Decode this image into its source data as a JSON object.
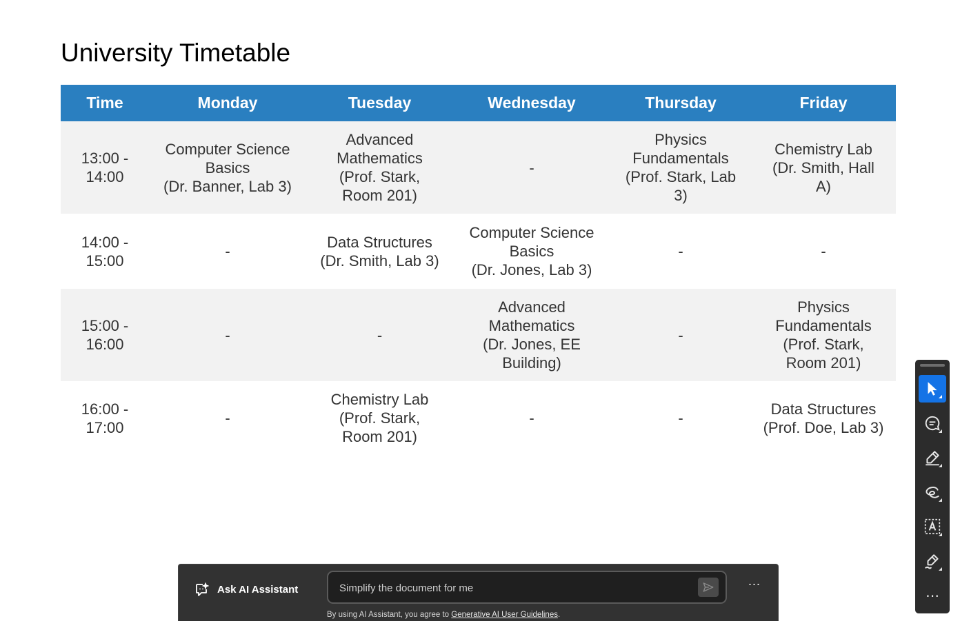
{
  "page": {
    "title": "University Timetable"
  },
  "timetable": {
    "headers": [
      "Time",
      "Monday",
      "Tuesday",
      "Wednesday",
      "Thursday",
      "Friday"
    ],
    "rows": [
      {
        "time": "13:00 -\n14:00",
        "cells": [
          "Computer Science\nBasics\n(Dr. Banner, Lab 3)",
          "Advanced\nMathematics\n(Prof. Stark,\nRoom 201)",
          "-",
          "Physics\nFundamentals\n(Prof. Stark, Lab\n3)",
          "Chemistry Lab\n(Dr. Smith, Hall\nA)"
        ]
      },
      {
        "time": "14:00 -\n15:00",
        "cells": [
          "-",
          "Data Structures\n(Dr. Smith, Lab 3)",
          "Computer Science\nBasics\n(Dr. Jones, Lab 3)",
          "-",
          "-"
        ]
      },
      {
        "time": "15:00 -\n16:00",
        "cells": [
          "-",
          "-",
          "Advanced\nMathematics\n(Dr. Jones, EE\nBuilding)",
          "-",
          "Physics\nFundamentals\n(Prof. Stark,\nRoom 201)"
        ]
      },
      {
        "time": "16:00 -\n17:00",
        "cells": [
          "-",
          "Chemistry Lab\n(Prof. Stark,\nRoom 201)",
          "-",
          "-",
          "Data Structures\n(Prof. Doe, Lab 3)"
        ]
      }
    ]
  },
  "tool_rail": {
    "tools": [
      {
        "name": "select-tool",
        "icon": "cursor-arrow-icon",
        "active": true
      },
      {
        "name": "comment-tool",
        "icon": "comment-bubble-icon",
        "active": false
      },
      {
        "name": "highlight-tool",
        "icon": "highlighter-pen-icon",
        "active": false
      },
      {
        "name": "draw-tool",
        "icon": "freehand-loop-icon",
        "active": false
      },
      {
        "name": "text-box-tool",
        "icon": "text-box-icon",
        "active": false
      },
      {
        "name": "sign-tool",
        "icon": "signature-pen-icon",
        "active": false
      }
    ],
    "more_label": "⋯"
  },
  "ai_assistant": {
    "label": "Ask AI Assistant",
    "input_placeholder": "Simplify the document for me",
    "more_label": "⋯",
    "disclaimer_prefix": "By using AI Assistant, you agree to ",
    "disclaimer_link": "Generative AI User Guidelines",
    "disclaimer_suffix": "."
  },
  "colors": {
    "header_bg": "#2a7fc0",
    "row_alt_bg": "#f2f2f2",
    "rail_bg": "#2c2c2c",
    "active_tool": "#1473e6",
    "ai_bar_bg": "#323232"
  }
}
